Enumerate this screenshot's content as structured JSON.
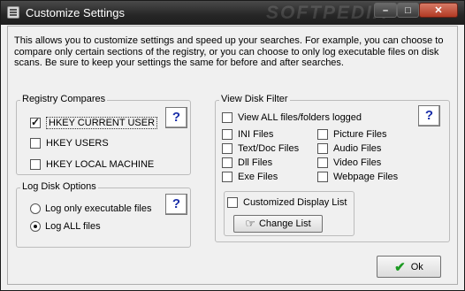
{
  "window": {
    "title": "Customize Settings",
    "watermark": "SOFTPEDIA"
  },
  "titlebar_buttons": {
    "minimize": "–",
    "maximize": "□",
    "close": "✕"
  },
  "intro": "This allows you to customize settings and speed up your searches.  For example, you can choose to compare only certain sections of the registry, or you can choose to only log executable files on disk scans.  Be sure to keep your settings the same for before and after searches.",
  "registry": {
    "legend": "Registry Compares",
    "items": [
      {
        "label": "HKEY CURRENT USER",
        "checked": true
      },
      {
        "label": "HKEY USERS",
        "checked": false
      },
      {
        "label": "HKEY LOCAL MACHINE",
        "checked": false
      }
    ],
    "help": "?"
  },
  "log_disk": {
    "legend": "Log Disk Options",
    "options": [
      {
        "label": "Log only executable files",
        "selected": false
      },
      {
        "label": "Log ALL files",
        "selected": true
      }
    ],
    "help": "?"
  },
  "view_disk": {
    "legend": "View Disk Filter",
    "view_all": "View ALL files/folders logged",
    "left": [
      "INI Files",
      "Text/Doc Files",
      "Dll Files",
      "Exe Files"
    ],
    "right": [
      "Picture Files",
      "Audio Files",
      "Video Files",
      "Webpage Files"
    ],
    "help": "?",
    "customized": "Customized Display List",
    "change_list": "Change List"
  },
  "ok_label": "Ok"
}
